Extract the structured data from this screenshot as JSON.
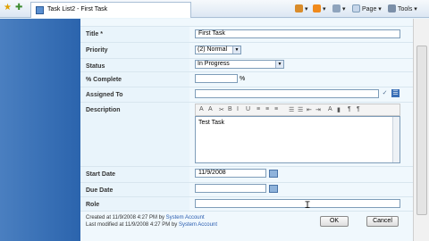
{
  "browser": {
    "tab_title": "Task List2 - First Task",
    "page_menu": "Page",
    "tools_menu": "Tools"
  },
  "form": {
    "title_label": "Title *",
    "title_value": "First Task",
    "priority_label": "Priority",
    "priority_value": "(2) Normal",
    "status_label": "Status",
    "status_value": "In Progress",
    "percent_label": "% Complete",
    "percent_value": "",
    "percent_sign": "%",
    "assigned_label": "Assigned To",
    "assigned_value": "",
    "description_label": "Description",
    "description_value": "Test Task",
    "start_label": "Start Date",
    "start_value": "11/9/2008",
    "due_label": "Due Date",
    "due_value": "",
    "role_label": "Role",
    "role_value": ""
  },
  "footer": {
    "created": "Created at 11/9/2008 4:27 PM  by ",
    "created_by": "System Account",
    "modified": "Last modified at 11/9/2008 4:27 PM  by ",
    "modified_by": "System Account"
  },
  "buttons": {
    "ok": "OK",
    "cancel": "Cancel"
  }
}
